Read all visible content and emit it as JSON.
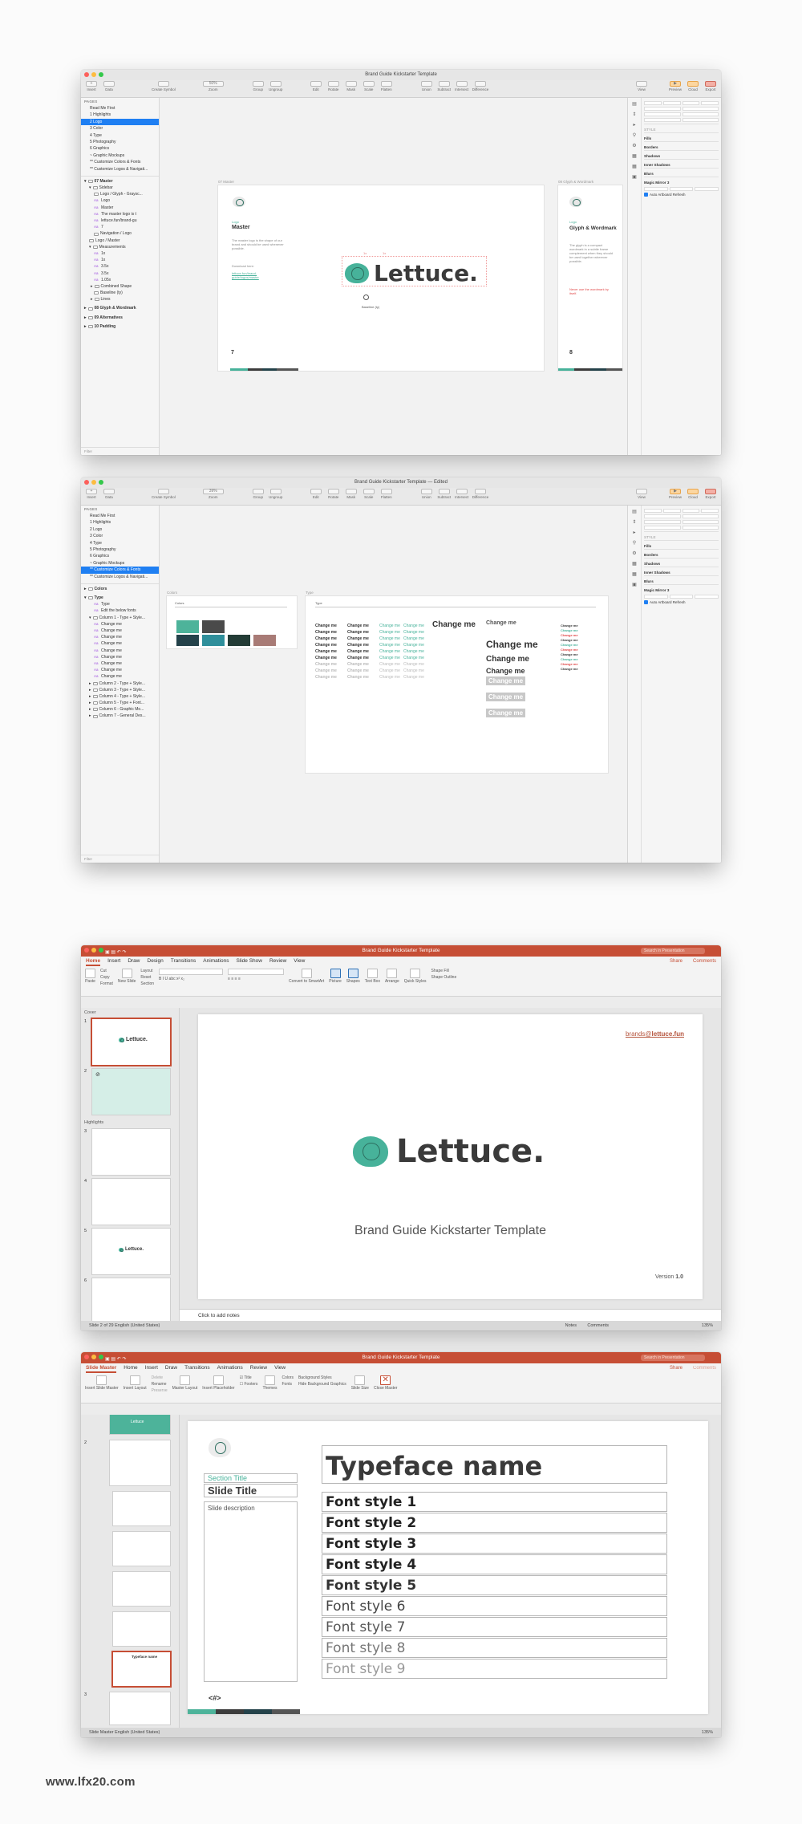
{
  "sketch1": {
    "title": "Brand Guide Kickstarter Template",
    "toolbar": [
      "Insert",
      "Data",
      "Create Symbol",
      "Zoom",
      "Group",
      "Ungroup",
      "Edit",
      "Rotate",
      "Mask",
      "Scale",
      "Flatten",
      "Union",
      "Subtract",
      "Intersect",
      "Difference",
      "View",
      "Preview",
      "Cloud",
      "Export"
    ],
    "zoom": "50%",
    "pages_header": "PAGES",
    "pages": [
      "Read Me First",
      "1 Highlights",
      "2 Logo",
      "3 Color",
      "4 Type",
      "5 Photography",
      "6 Graphics",
      "~ Graphic Mockups",
      "** Customize Colors & Fonts",
      "** Customize Logos & Navigati..."
    ],
    "selected_page": 2,
    "layers": [
      "07 Master",
      "Sidebar",
      "Logo / Glyph - Graysc...",
      "Logo",
      "Master",
      "The master logo is t",
      "lettuce.fun/brand-gu",
      "7",
      "Navigation / Logo",
      "Logo / Master",
      "Measurements",
      "1x",
      "1x",
      "3.5x",
      "3.5x",
      "1.05x",
      "Combined Shape",
      "Baseline (ty)",
      "Lines",
      "08 Glyph & Wordmark",
      "09 Alternatives",
      "10 Padding"
    ],
    "filter": "Filter",
    "artboard1_label": "07 Master",
    "artboard2_label": "08 Glyph & Wordmark",
    "sidebar_kicker": "Logo",
    "sidebar_title": "Master",
    "sidebar_body": "The master logo is the shape of our brand and should be used whenever possible.",
    "download": "Download here:",
    "link": "lettuce.fun/brand-guide/logos/master",
    "page_num": "7",
    "wordmark": "Lettuce.",
    "baseline": "Baseline (ty)",
    "meas_top": "1x",
    "meas_side": "1x",
    "ab2_kicker": "Logo",
    "ab2_title": "Glyph & Wordmark",
    "ab2_body": "The glyph is a compact wordmark in a subtle frame complement when they should be used together wherever possible.",
    "ab2_red": "Never use the wordmark by itself.",
    "ab2_num": "8",
    "inspector": [
      "STYLE",
      "Fills",
      "Borders",
      "Shadows",
      "Inner Shadows",
      "Blurs",
      "Magic Mirror 3",
      "Auto Artboard Refresh"
    ]
  },
  "sketch2": {
    "title": "Brand Guide Kickstarter Template — Edited",
    "zoom": "39%",
    "pages_header": "PAGES",
    "pages": [
      "Read Me First",
      "1 Highlights",
      "2 Logo",
      "3 Color",
      "4 Type",
      "5 Photography",
      "6 Graphics",
      "~ Graphic Mockups",
      "** Customize Colors & Fonts",
      "** Customize Logos & Navigati..."
    ],
    "selected_page": 8,
    "layers": [
      "Colors",
      "Type",
      "Type",
      "Edit the below fonts",
      "Column 1 - Type + Style...",
      "Change me",
      "Change me",
      "Change me",
      "Change me",
      "Change me",
      "Change me",
      "Change me",
      "Change me",
      "Change me",
      "Column 2 - Type + Style...",
      "Column 3 - Type + Style...",
      "Column 4 - Type + Style...",
      "Column 5 - Type + Font...",
      "Column 6 - Graphic Mo...",
      "Column 7 - General Des..."
    ],
    "filter": "Filter",
    "artboard1_label": "Colors",
    "artboard2_label": "Type",
    "change_me": "Change me",
    "colors": [
      "#4db39a",
      "#4a4a4a",
      "#24424a",
      "#2f8f9b",
      "#233c36",
      "#a87b76"
    ]
  },
  "ppt1": {
    "title": "Brand Guide Kickstarter Template",
    "search": "Search in Presentation",
    "tabs": [
      "Home",
      "Insert",
      "Draw",
      "Design",
      "Transitions",
      "Animations",
      "Slide Show",
      "Review",
      "View"
    ],
    "active_tab": "Home",
    "share": "Share",
    "comments": "Comments",
    "ribbon": [
      "Paste",
      "Cut",
      "Copy",
      "Format",
      "New Slide",
      "Layout",
      "Reset",
      "Section",
      "Convert to SmartArt",
      "Picture",
      "Shapes",
      "Text Box",
      "Arrange",
      "Quick Styles",
      "Shape Fill",
      "Shape Outline"
    ],
    "sections": [
      "Cover",
      "Highlights"
    ],
    "slide_title": "Brand Guide Kickstarter Template",
    "wordmark": "Lettuce.",
    "url_prefix": "brands@",
    "url_bold": "lettuce.fun",
    "version_prefix": "Version ",
    "version_bold": "1.0",
    "notes": "Click to add notes",
    "status": "Slide 2 of 29     English (United States)",
    "notes_btn": "Notes",
    "comments_btn": "Comments",
    "zoom": "135%"
  },
  "ppt2": {
    "title": "Brand Guide Kickstarter Template",
    "search": "Search in Presentation",
    "tabs": [
      "Slide Master",
      "Home",
      "Insert",
      "Draw",
      "Transitions",
      "Animations",
      "Review",
      "View"
    ],
    "active_tab": "Slide Master",
    "share": "Share",
    "comments": "Comments",
    "ribbon": [
      "Insert Slide Master",
      "Insert Layout",
      "Delete",
      "Rename",
      "Preserve",
      "Master Layout",
      "Insert Placeholder",
      "Title",
      "Footers",
      "Themes",
      "Colors",
      "Fonts",
      "Background Styles",
      "Hide Background Graphics",
      "Slide Size",
      "Close Master"
    ],
    "thumb_label": "Lettuce",
    "section_title": "Section Title",
    "slide_title": "Slide Title",
    "slide_desc": "Slide description",
    "typeface": "Typeface name",
    "styles": [
      "Font style 1",
      "Font style 2",
      "Font style 3",
      "Font style 4",
      "Font style 5",
      "Font style 6",
      "Font style 7",
      "Font style 8",
      "Font style 9"
    ],
    "page_placeholder": "<#>",
    "status": "Slide Master     English (United States)",
    "zoom": "135%"
  },
  "watermark": "www.lfx20.com"
}
